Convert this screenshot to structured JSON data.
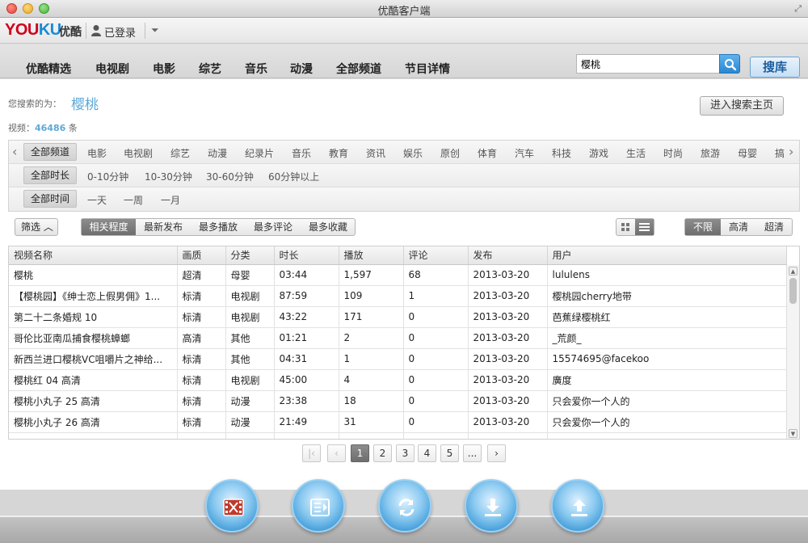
{
  "window": {
    "title": "优酷客户端"
  },
  "brand": {
    "logo_you": "YOU",
    "logo_ku": "KU",
    "logo_cn": "优酷",
    "login_status": "已登录"
  },
  "nav": {
    "items": [
      "优酷精选",
      "电视剧",
      "电影",
      "综艺",
      "音乐",
      "动漫",
      "全部频道",
      "节目详情"
    ],
    "search_value": "樱桃",
    "search_button": "搜库"
  },
  "search": {
    "label": "您搜索的为：",
    "term": "樱桃",
    "video_label": "视频：",
    "count": "46486",
    "count_unit": "条",
    "enter_home": "进入搜索主页"
  },
  "filters": {
    "channels": [
      "全部频道",
      "电影",
      "电视剧",
      "综艺",
      "动漫",
      "纪录片",
      "音乐",
      "教育",
      "资讯",
      "娱乐",
      "原创",
      "体育",
      "汽车",
      "科技",
      "游戏",
      "生活",
      "时尚",
      "旅游",
      "母婴",
      "搞"
    ],
    "durations": [
      "全部时长",
      "0-10分钟",
      "10-30分钟",
      "30-60分钟",
      "60分钟以上"
    ],
    "times": [
      "全部时间",
      "一天",
      "一周",
      "一月"
    ]
  },
  "sort": {
    "filter_button": "筛选",
    "options": [
      "相关程度",
      "最新发布",
      "最多播放",
      "最多评论",
      "最多收藏"
    ],
    "quality": [
      "不限",
      "高清",
      "超清"
    ]
  },
  "table": {
    "headers": [
      "视频名称",
      "画质",
      "分类",
      "时长",
      "播放",
      "评论",
      "发布",
      "用户"
    ],
    "rows": [
      [
        "樱桃",
        "超清",
        "母婴",
        "03:44",
        "1,597",
        "68",
        "2013-03-20",
        "lululens"
      ],
      [
        "【樱桃园】《绅士恋上假男佣》1...",
        "标清",
        "电视剧",
        "87:59",
        "109",
        "1",
        "2013-03-20",
        "樱桃园cherry地带"
      ],
      [
        "第二十二条婚规 10",
        "标清",
        "电视剧",
        "43:22",
        "171",
        "0",
        "2013-03-20",
        "芭蕉绿樱桃红"
      ],
      [
        "哥伦比亚南瓜捕食樱桃蟑螂",
        "高清",
        "其他",
        "01:21",
        "2",
        "0",
        "2013-03-20",
        "_荒颜_"
      ],
      [
        "新西兰进口樱桃VC咀嚼片之神给...",
        "标清",
        "其他",
        "04:31",
        "1",
        "0",
        "2013-03-20",
        "15574695@facekoo"
      ],
      [
        "樱桃红 04 高清",
        "标清",
        "电视剧",
        "45:00",
        "4",
        "0",
        "2013-03-20",
        "廣度"
      ],
      [
        "樱桃小丸子 25 高清",
        "标清",
        "动漫",
        "23:38",
        "18",
        "0",
        "2013-03-20",
        "只会爱你一个人的"
      ],
      [
        "樱桃小丸子 26 高清",
        "标清",
        "动漫",
        "21:49",
        "31",
        "0",
        "2013-03-20",
        "只会爱你一个人的"
      ],
      [
        "",
        "",
        "",
        "",
        "",
        "",
        "",
        ""
      ]
    ]
  },
  "pager": {
    "pages": [
      "1",
      "2",
      "3",
      "4",
      "5",
      "..."
    ]
  },
  "dock": {
    "icons": [
      "film-icon",
      "playlist-icon",
      "refresh-icon",
      "download-icon",
      "upload-icon"
    ]
  }
}
